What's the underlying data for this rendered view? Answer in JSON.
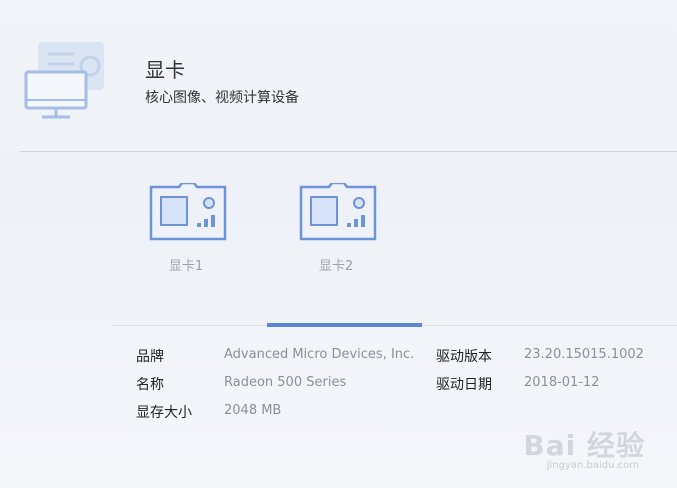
{
  "header": {
    "title": "显卡",
    "subtitle": "核心图像、视频计算设备"
  },
  "cards": [
    {
      "label": "显卡1"
    },
    {
      "label": "显卡2"
    }
  ],
  "details": {
    "left": [
      {
        "key": "品牌",
        "value": "Advanced Micro Devices, Inc."
      },
      {
        "key": "名称",
        "value": "Radeon 500 Series"
      },
      {
        "key": "显存大小",
        "value": "2048 MB"
      }
    ],
    "right": [
      {
        "key": "驱动版本",
        "value": "23.20.15015.1002"
      },
      {
        "key": "驱动日期",
        "value": "2018-01-12"
      }
    ]
  },
  "watermark": {
    "main": "Bai 经验",
    "url": "jingyan.baidu.com"
  },
  "colors": {
    "accent": "#5d85d6",
    "icon_stroke": "#6f93d8",
    "icon_fill": "#d6e2f7"
  }
}
